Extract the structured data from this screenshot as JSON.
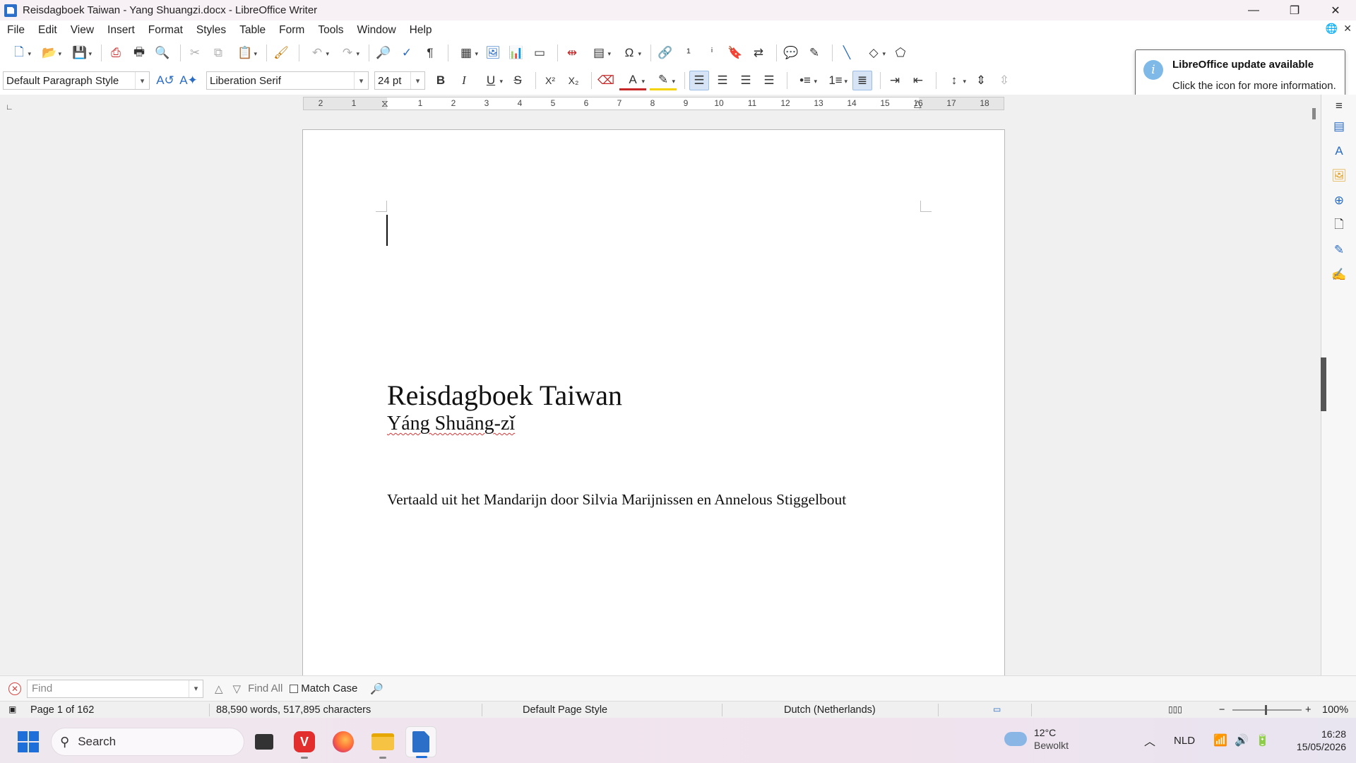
{
  "window": {
    "title": "Reisdagboek Taiwan - Yang Shuangzi.docx - LibreOffice Writer",
    "minimize": "—",
    "restore": "❐",
    "close": "✕"
  },
  "menu": {
    "items": [
      "File",
      "Edit",
      "View",
      "Insert",
      "Format",
      "Styles",
      "Table",
      "Form",
      "Tools",
      "Window",
      "Help"
    ]
  },
  "formatting": {
    "paragraph_style": "Default Paragraph Style",
    "font_name": "Liberation Serif",
    "font_size": "24 pt",
    "bold": "B",
    "italic": "I",
    "underline": "U",
    "strikethrough": "S",
    "superscript": "X²",
    "subscript": "X₂"
  },
  "notification": {
    "title": "LibreOffice update available",
    "text": "Click the icon for more information."
  },
  "ruler": {
    "labels": [
      "2",
      "1",
      "1",
      "2",
      "3",
      "4",
      "5",
      "6",
      "7",
      "8",
      "9",
      "10",
      "11",
      "12",
      "13",
      "14",
      "15",
      "16",
      "17",
      "18"
    ]
  },
  "document": {
    "title": "Reisdagboek Taiwan",
    "author": "Yáng Shuāng-zǐ",
    "translation_note": "Vertaald uit het Mandarijn door Silvia Marijnissen en Annelous Stiggelbout"
  },
  "findbar": {
    "placeholder": "Find",
    "find_all": "Find All",
    "match_case": "Match Case"
  },
  "statusbar": {
    "page": "Page 1 of 162",
    "word_count": "88,590 words, 517,895 characters",
    "page_style": "Default Page Style",
    "language": "Dutch (Netherlands)",
    "zoom": "100%"
  },
  "taskbar": {
    "search_label": "Search",
    "weather_temp": "12°C",
    "weather_desc": "Bewolkt",
    "language": "NLD",
    "time": "16:28",
    "date": "15/05/2026"
  },
  "colors": {
    "accent": "#2a6cc4",
    "font_color_bar": "#c62828",
    "highlight_bar": "#f5d300"
  }
}
